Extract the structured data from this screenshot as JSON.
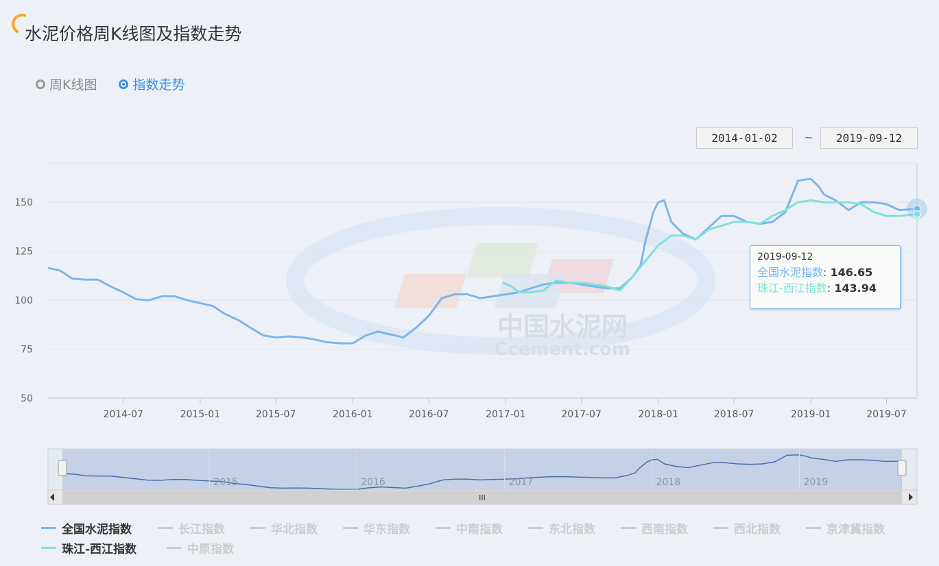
{
  "header": {
    "title": "水泥价格周K线图及指数走势"
  },
  "view_toggle": {
    "options": [
      {
        "label": "周K线图",
        "selected": false
      },
      {
        "label": "指数走势",
        "selected": true
      }
    ]
  },
  "date_range": {
    "start": "2014-01-02",
    "end": "2019-09-12",
    "separator": "~"
  },
  "watermark": {
    "cn": "中国水泥网",
    "en": "Ccement.com"
  },
  "navigator": {
    "year_labels": [
      "2015",
      "2016",
      "2017",
      "2018",
      "2019"
    ],
    "handle_label": "III"
  },
  "tooltip": {
    "date": "2019-09-12",
    "rows": [
      {
        "name": "全国水泥指数",
        "value": "146.65",
        "color": "#7cb5ec"
      },
      {
        "name": "珠江-西江指数",
        "value": "143.94",
        "color": "#7ee3d6"
      }
    ]
  },
  "legend": {
    "items": [
      {
        "label": "全国水泥指数",
        "active": true,
        "color": "#7cb5ec"
      },
      {
        "label": "长江指数",
        "active": false,
        "color": "#cccccc"
      },
      {
        "label": "华北指数",
        "active": false,
        "color": "#cccccc"
      },
      {
        "label": "华东指数",
        "active": false,
        "color": "#cccccc"
      },
      {
        "label": "中南指数",
        "active": false,
        "color": "#cccccc"
      },
      {
        "label": "东北指数",
        "active": false,
        "color": "#cccccc"
      },
      {
        "label": "西南指数",
        "active": false,
        "color": "#cccccc"
      },
      {
        "label": "西北指数",
        "active": false,
        "color": "#cccccc"
      },
      {
        "label": "京津冀指数",
        "active": false,
        "color": "#cccccc"
      },
      {
        "label": "珠江-西江指数",
        "active": true,
        "color": "#7ee3d6"
      },
      {
        "label": "中原指数",
        "active": false,
        "color": "#cccccc"
      }
    ]
  },
  "chart_data": {
    "type": "line",
    "xlim": [
      "2014-01-02",
      "2019-09-12"
    ],
    "ylim": [
      50,
      170
    ],
    "yticks": [
      50,
      75,
      100,
      125,
      150
    ],
    "xticks": [
      "2014-07",
      "2015-01",
      "2015-07",
      "2016-01",
      "2016-07",
      "2017-01",
      "2017-07",
      "2018-01",
      "2018-07",
      "2019-01",
      "2019-07"
    ],
    "grid": true,
    "legend_position": "bottom",
    "series": [
      {
        "name": "全国水泥指数",
        "color": "#7cb5ec",
        "x": [
          "2014-01-02",
          "2014-02-01",
          "2014-03-01",
          "2014-04-01",
          "2014-05-01",
          "2014-06-01",
          "2014-07-01",
          "2014-08-01",
          "2014-09-01",
          "2014-10-01",
          "2014-11-01",
          "2014-12-01",
          "2015-01-01",
          "2015-02-01",
          "2015-03-01",
          "2015-04-01",
          "2015-05-01",
          "2015-06-01",
          "2015-07-01",
          "2015-08-01",
          "2015-09-01",
          "2015-10-01",
          "2015-11-01",
          "2015-12-01",
          "2016-01-01",
          "2016-02-01",
          "2016-03-01",
          "2016-04-01",
          "2016-05-01",
          "2016-06-01",
          "2016-07-01",
          "2016-08-01",
          "2016-09-01",
          "2016-10-01",
          "2016-11-01",
          "2016-12-01",
          "2017-01-01",
          "2017-02-01",
          "2017-03-01",
          "2017-04-01",
          "2017-05-01",
          "2017-06-01",
          "2017-07-01",
          "2017-08-01",
          "2017-09-01",
          "2017-10-01",
          "2017-11-01",
          "2017-11-20",
          "2017-12-01",
          "2017-12-20",
          "2018-01-01",
          "2018-01-15",
          "2018-02-01",
          "2018-03-01",
          "2018-04-01",
          "2018-05-01",
          "2018-06-01",
          "2018-07-01",
          "2018-08-01",
          "2018-09-01",
          "2018-10-01",
          "2018-11-01",
          "2018-11-20",
          "2018-12-01",
          "2019-01-01",
          "2019-01-20",
          "2019-02-01",
          "2019-03-01",
          "2019-04-01",
          "2019-05-01",
          "2019-06-01",
          "2019-07-01",
          "2019-08-01",
          "2019-09-12"
        ],
        "values": [
          116.5,
          115,
          111,
          110.5,
          110.5,
          107,
          104,
          100.5,
          100,
          102,
          102,
          100,
          98.5,
          97,
          93,
          90,
          86,
          82,
          81,
          81.5,
          81,
          80,
          78.5,
          78,
          78,
          82,
          84,
          82.5,
          81,
          86,
          92,
          101,
          103,
          103,
          101,
          102,
          103,
          104,
          106,
          108,
          109,
          109,
          108,
          107,
          106,
          106,
          112,
          118,
          130,
          145,
          150,
          151,
          140,
          134,
          131,
          137,
          143,
          143,
          140,
          139,
          140,
          145,
          155,
          161,
          162,
          158,
          154,
          151,
          146,
          150,
          150,
          149,
          146,
          146.65
        ]
      },
      {
        "name": "珠江-西江指数",
        "color": "#7ee3d6",
        "x": [
          "2016-12-25",
          "2017-01-15",
          "2017-02-01",
          "2017-03-01",
          "2017-04-01",
          "2017-05-01",
          "2017-06-01",
          "2017-07-01",
          "2017-08-01",
          "2017-09-01",
          "2017-10-01",
          "2017-11-01",
          "2017-12-01",
          "2018-01-01",
          "2018-02-01",
          "2018-03-01",
          "2018-04-01",
          "2018-05-01",
          "2018-06-01",
          "2018-07-01",
          "2018-08-01",
          "2018-09-01",
          "2018-10-01",
          "2018-11-01",
          "2018-12-01",
          "2019-01-01",
          "2019-02-01",
          "2019-03-01",
          "2019-04-01",
          "2019-05-01",
          "2019-06-01",
          "2019-07-01",
          "2019-08-01",
          "2019-09-12"
        ],
        "values": [
          109,
          107,
          104,
          104,
          105,
          110,
          109,
          109,
          108,
          107,
          105,
          112,
          120,
          128,
          133,
          133,
          131,
          136,
          138,
          140,
          140,
          139,
          143,
          146,
          150,
          151,
          150,
          150,
          150,
          149,
          145,
          143,
          143,
          143.94
        ]
      }
    ]
  }
}
